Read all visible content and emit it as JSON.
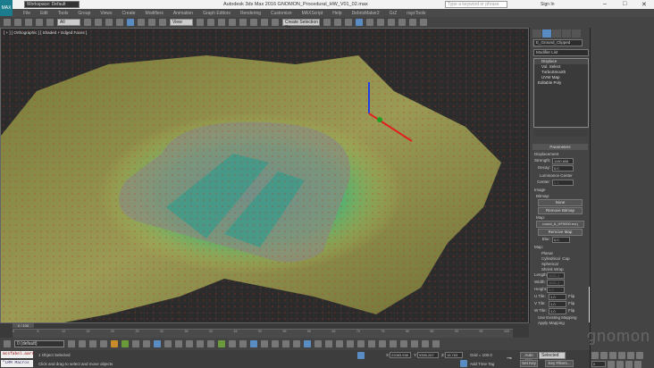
{
  "title_bar": {
    "title": "Autodesk 3ds Max 2016    GNOMON_Procedural_HW_V01_02.max",
    "workspace": "Workspace: Default",
    "search_placeholder": "Type a keyword or phrase",
    "sign_in": "Sign In",
    "min": "–",
    "max": "□",
    "close": "✕",
    "app_logo": "MAX"
  },
  "menu": [
    "File",
    "Edit",
    "Tools",
    "Group",
    "Views",
    "Create",
    "Modifiers",
    "Animation",
    "Graph Editors",
    "Rendering",
    "Customize",
    "MAXScript",
    "Help",
    "DebrisMaker2",
    "GrZ",
    "rayzTools"
  ],
  "toolbar": {
    "filter": "All",
    "ref_coord": "View",
    "selection_set": "Create Selection Se"
  },
  "viewport": {
    "label": "[ + ] [ Orthographic ] [ Shaded + Edged Faces ]"
  },
  "command_panel": {
    "object_name": "E_Ground_Clipped",
    "modifier_list": "Modifier List",
    "stack": [
      "Displace",
      "Vol. Select",
      "TurboSmooth",
      "UVW Map",
      "Editable Poly"
    ],
    "rollout": "Parameters",
    "displacement": {
      "group": "Displacement",
      "strength_label": "Strength:",
      "strength": "1190.606",
      "decay_label": "Decay:",
      "decay": "0.0",
      "luminance_center": "Luminance Center",
      "center_label": "Center:",
      "center": "0.5"
    },
    "image": {
      "group": "Image",
      "bitmap_label": "Bitmap:",
      "bitmap_btn": "None",
      "remove_bitmap": "Remove Bitmap",
      "map_label": "Map:",
      "map_btn": "round_A_HF0000.exr)",
      "remove_map": "Remove Map",
      "blur_label": "Blur:",
      "blur": "0.0"
    },
    "map": {
      "group": "Map:",
      "planar": "Planar",
      "cylindrical": "Cylindrical",
      "cap": "Cap",
      "spherical": "Spherical",
      "shrink_wrap": "Shrink Wrap",
      "length_label": "Length:",
      "length": "1021.1",
      "width_label": "Width:",
      "width": "1021.1",
      "height_label": "Height:",
      "height": "1.0",
      "u_tile_label": "U Tile:",
      "u_tile": "1.0",
      "v_tile_label": "V Tile:",
      "v_tile": "1.0",
      "w_tile_label": "W Tile:",
      "w_tile": "1.0",
      "flip": "Flip",
      "use_existing": "Use Existing Mapping",
      "apply_mapping": "Apply Mapping"
    }
  },
  "watermark": "gnomon",
  "timeline": {
    "frame": "0 / 100",
    "ticks": [
      "0",
      "5",
      "10",
      "15",
      "20",
      "25",
      "30",
      "35",
      "40",
      "45",
      "50",
      "55",
      "60",
      "65",
      "70",
      "75",
      "80",
      "85",
      "90",
      "95",
      "100"
    ]
  },
  "bottom": {
    "layer": "0 (default)",
    "scripts": [
      "mcsfabel.aars",
      "\"LMM Macros"
    ],
    "status1": "1 Object Selected",
    "status2": "Click and drag to select and move objects",
    "x_label": "X:",
    "x": "22083.938",
    "y_label": "Y:",
    "y": "9355.267",
    "z_label": "Z:",
    "z": "15.763",
    "grid": "Grid = 100.0",
    "add_time_tag": "Add Time Tag",
    "auto_key": "Auto Key",
    "selected": "Selected",
    "set_key": "Set Key",
    "key_filters": "Key Filters...",
    "frame_field": "0"
  }
}
